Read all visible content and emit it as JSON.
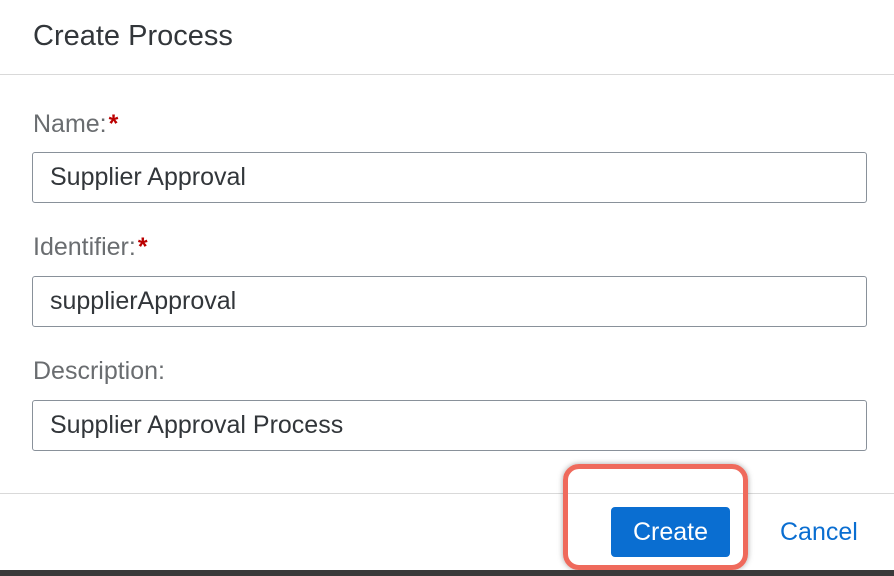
{
  "dialog": {
    "title": "Create Process"
  },
  "form": {
    "name": {
      "label": "Name:",
      "required_marker": "*",
      "value": "Supplier Approval"
    },
    "identifier": {
      "label": "Identifier:",
      "required_marker": "*",
      "value": "supplierApproval"
    },
    "description": {
      "label": "Description:",
      "value": "Supplier Approval Process"
    }
  },
  "footer": {
    "create_label": "Create",
    "cancel_label": "Cancel"
  },
  "colors": {
    "accent": "#0a6ed1",
    "required": "#bb0000",
    "highlight": "#ef6a5c"
  }
}
